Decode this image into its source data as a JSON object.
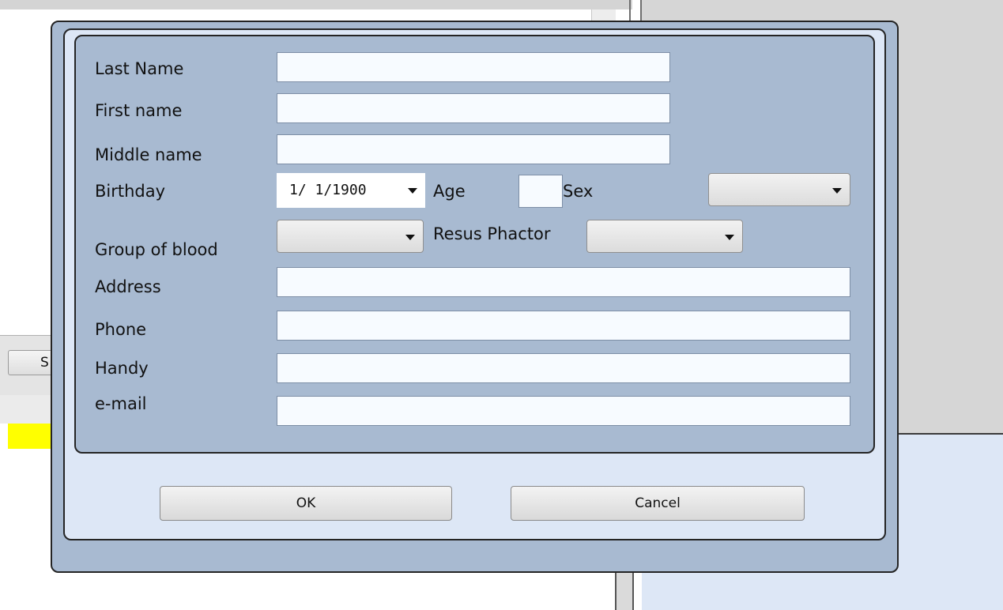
{
  "background": {
    "toolbar_button_partial_label": "S"
  },
  "form": {
    "last_name_label": "Last Name",
    "last_name_value": "",
    "first_name_label": "First name",
    "first_name_value": "",
    "middle_name_label": "Middle name",
    "middle_name_value": "",
    "birthday_label": "Birthday",
    "birthday_value": "1/ 1/1900",
    "age_label": "Age",
    "age_value": "",
    "sex_label": "Sex",
    "sex_value": "",
    "blood_group_label": "Group of blood",
    "blood_group_value": "",
    "rh_factor_label": "Resus Phactor",
    "rh_factor_value": "",
    "address_label": "Address",
    "address_value": "",
    "phone_label": "Phone",
    "phone_value": "",
    "handy_label": "Handy",
    "handy_value": "",
    "email_label": "e-mail",
    "email_value": ""
  },
  "buttons": {
    "ok": "OK",
    "cancel": "Cancel"
  },
  "colors": {
    "dialog_bg": "#a8bad1",
    "dialog_inner_bg": "#dde7f6",
    "field_bg": "#f7fbff",
    "highlight_yellow": "#ffff00"
  },
  "icons": {
    "dropdown": "chevron-down-icon"
  }
}
